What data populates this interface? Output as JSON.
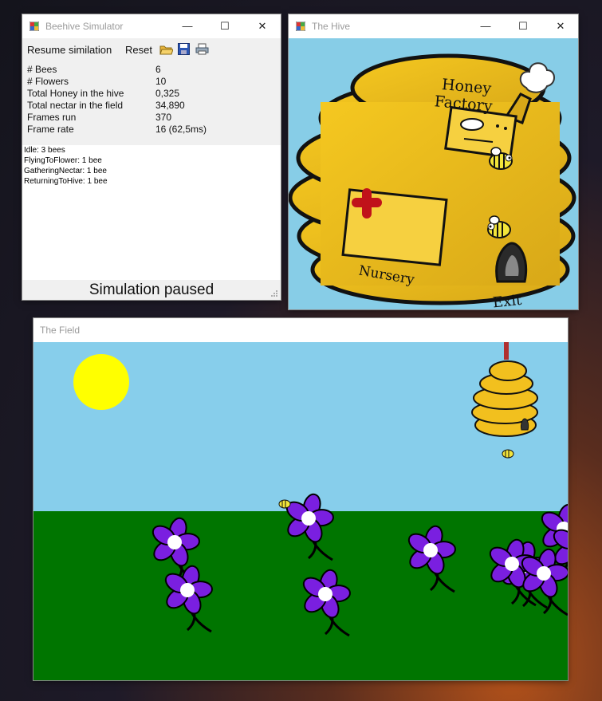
{
  "main_window": {
    "title": "Beehive Simulator",
    "menu": {
      "resume_label": "Resume similation",
      "reset_label": "Reset"
    },
    "toolbar_icons": [
      "open-folder-icon",
      "save-icon",
      "print-icon"
    ],
    "stats": [
      {
        "label": "# Bees",
        "value": "6"
      },
      {
        "label": "# Flowers",
        "value": "10"
      },
      {
        "label": "Total Honey in the hive",
        "value": "0,325"
      },
      {
        "label": "Total nectar in the field",
        "value": "34,890"
      },
      {
        "label": "Frames run",
        "value": "370"
      },
      {
        "label": "Frame rate",
        "value": "16 (62,5ms)"
      }
    ],
    "log": [
      "Idle: 3 bees",
      "FlyingToFlower: 1 bee",
      "GatheringNectar: 1 bee",
      "ReturningToHive: 1 bee"
    ],
    "status": "Simulation paused"
  },
  "hive_window": {
    "title": "The Hive",
    "labels": {
      "factory": "Honey\nFactory",
      "factory_line1": "Honey",
      "factory_line2": "Factory",
      "nursery": "Nursery",
      "exit": "Exit"
    },
    "colors": {
      "sky": "#87cde7",
      "hive": "#f2c01e",
      "outline": "#111111",
      "cross": "#c0121a"
    }
  },
  "field_window": {
    "title": "The Field",
    "colors": {
      "sky": "#87ceeb",
      "grass": "#007500",
      "sun": "#ffff00",
      "petal": "#7a1fe0",
      "flower_center": "#ffffff",
      "stem": "#000000"
    },
    "flower_count": 10
  },
  "window_controls": {
    "minimize": "—",
    "maximize": "☐",
    "close": "✕"
  }
}
